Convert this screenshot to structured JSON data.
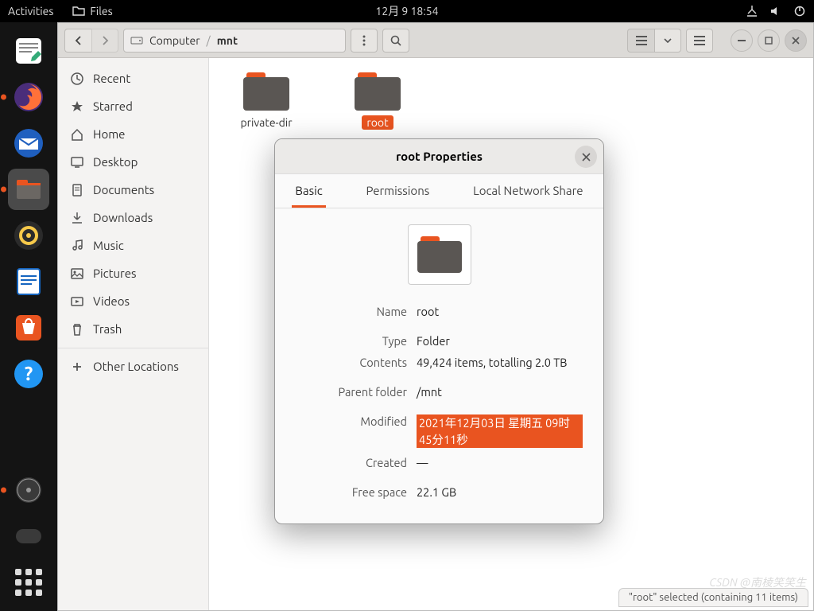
{
  "topbar": {
    "activities": "Activities",
    "app_name": "Files",
    "datetime": "12月 9  18:54"
  },
  "dock": {
    "items": [
      {
        "name": "text-editor",
        "running": false
      },
      {
        "name": "firefox",
        "running": true
      },
      {
        "name": "thunderbird",
        "running": false
      },
      {
        "name": "files",
        "running": true,
        "active": true
      },
      {
        "name": "rhythmbox",
        "running": false
      },
      {
        "name": "libreoffice-writer",
        "running": false
      },
      {
        "name": "software-center",
        "running": false
      },
      {
        "name": "help",
        "running": false
      }
    ]
  },
  "path": {
    "root": "Computer",
    "segments": [
      "mnt"
    ]
  },
  "sidebar": {
    "items": [
      {
        "icon": "recent",
        "label": "Recent"
      },
      {
        "icon": "starred",
        "label": "Starred"
      },
      {
        "icon": "home",
        "label": "Home"
      },
      {
        "icon": "desktop",
        "label": "Desktop"
      },
      {
        "icon": "documents",
        "label": "Documents"
      },
      {
        "icon": "downloads",
        "label": "Downloads"
      },
      {
        "icon": "music",
        "label": "Music"
      },
      {
        "icon": "pictures",
        "label": "Pictures"
      },
      {
        "icon": "videos",
        "label": "Videos"
      },
      {
        "icon": "trash",
        "label": "Trash"
      },
      {
        "icon": "other",
        "label": "Other Locations",
        "sep": true
      }
    ]
  },
  "files": [
    {
      "name": "private-dir",
      "selected": false
    },
    {
      "name": "root",
      "selected": true
    }
  ],
  "statusbar": "\"root\" selected (containing 11 items)",
  "watermark": "CSDN @南棱笑笑生",
  "dialog": {
    "title": "root Properties",
    "tabs": [
      "Basic",
      "Permissions",
      "Local Network Share"
    ],
    "props": {
      "name_label": "Name",
      "name": "root",
      "type_label": "Type",
      "type": "Folder",
      "contents_label": "Contents",
      "contents": "49,424 items, totalling 2.0 TB",
      "parent_label": "Parent folder",
      "parent": "/mnt",
      "modified_label": "Modified",
      "modified": "2021年12月03日 星期五 09时45分11秒",
      "created_label": "Created",
      "created": "—",
      "free_label": "Free space",
      "free": "22.1 GB"
    }
  }
}
